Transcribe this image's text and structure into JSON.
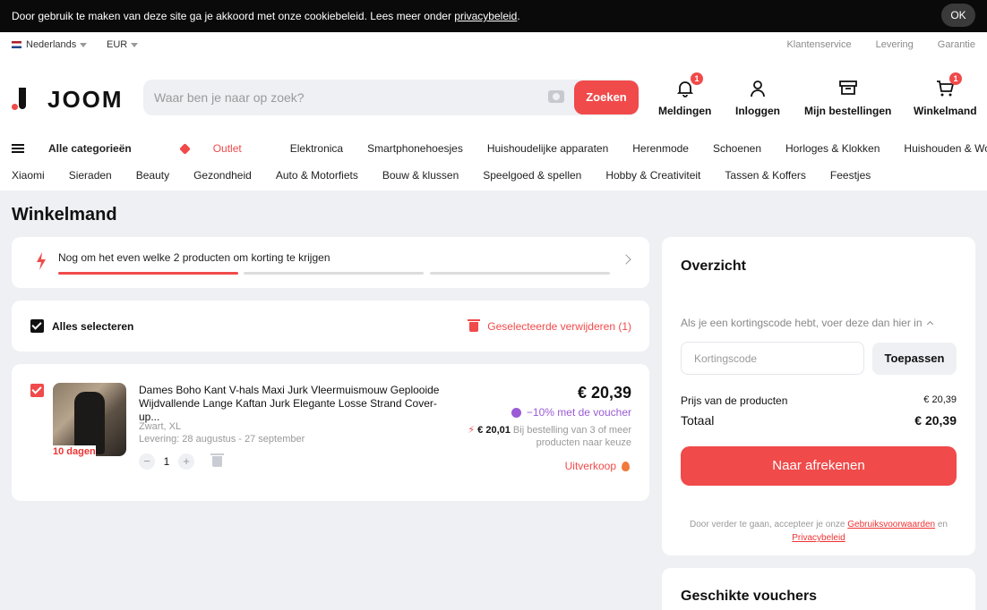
{
  "cookie": {
    "text": "Door gebruik te maken van deze site ga je akkoord met onze cookiebeleid. Lees meer onder ",
    "link": "privacybeleid",
    "after": ".",
    "ok": "OK"
  },
  "topbar": {
    "language": "Nederlands",
    "currency": "EUR",
    "links": [
      "Klantenservice",
      "Levering",
      "Garantie"
    ]
  },
  "logo": "JOOM",
  "search": {
    "placeholder": "Waar ben je naar op zoek?",
    "button": "Zoeken"
  },
  "header_actions": {
    "notifications": {
      "label": "Meldingen",
      "badge": "1"
    },
    "login": {
      "label": "Inloggen"
    },
    "orders": {
      "label": "Mijn bestellingen"
    },
    "cart": {
      "label": "Winkelmand",
      "badge": "1"
    }
  },
  "nav": {
    "all_categories": "Alle categorieën",
    "outlet": "Outlet",
    "row1": [
      "Elektronica",
      "Smartphonehoesjes",
      "Huishoudelijke apparaten",
      "Herenmode",
      "Schoenen",
      "Horloges & Klokken",
      "Huishouden & Wonen"
    ],
    "row2": [
      "Xiaomi",
      "Sieraden",
      "Beauty",
      "Gezondheid",
      "Auto & Motorfiets",
      "Bouw & klussen",
      "Speelgoed & spellen",
      "Hobby & Creativiteit",
      "Tassen & Koffers",
      "Feestjes"
    ]
  },
  "page_title": "Winkelmand",
  "promo": {
    "text": "Nog om het even welke 2 producten om korting te krijgen",
    "progress_segments_filled": 1,
    "progress_segments_total": 3
  },
  "select_all": {
    "label": "Alles selecteren",
    "delete": "Geselecteerde verwijderen (1)",
    "checked": true
  },
  "item": {
    "title": "Dames Boho Kant V-hals Maxi Jurk Vleermuismouw Geplooide Wijdvallende Lange Kaftan Jurk Elegante Losse Strand Cover-up...",
    "variant": "Zwart, XL",
    "delivery": "Levering: 28 augustus - 27 september",
    "days": "10 dagen",
    "quantity": "1",
    "price": "€ 20,39",
    "voucher": "−10% met de voucher",
    "bulk_price": "€ 20,01",
    "bulk_text": " Bij bestelling van 3 of meer producten naar keuze",
    "sale": "Uitverkoop",
    "checked": true
  },
  "overview": {
    "title": "Overzicht",
    "code_hint": "Als je een kortingscode hebt, voer deze dan hier in",
    "code_placeholder": "Kortingscode",
    "apply": "Toepassen",
    "subtotal_label": "Prijs van de producten",
    "subtotal_value": "€ 20,39",
    "total_label": "Totaal",
    "total_value": "€ 20,39",
    "checkout": "Naar afrekenen",
    "terms_prefix": "Door verder te gaan, accepteer je onze ",
    "terms_link": "Gebruiksvoorwaarden",
    "terms_mid": " en ",
    "privacy_link": "Privacybeleid"
  },
  "vouchers_title": "Geschikte vouchers",
  "colors": {
    "accent": "#f04a4a",
    "voucher": "#9b5bd6",
    "background": "#eef0f4"
  }
}
